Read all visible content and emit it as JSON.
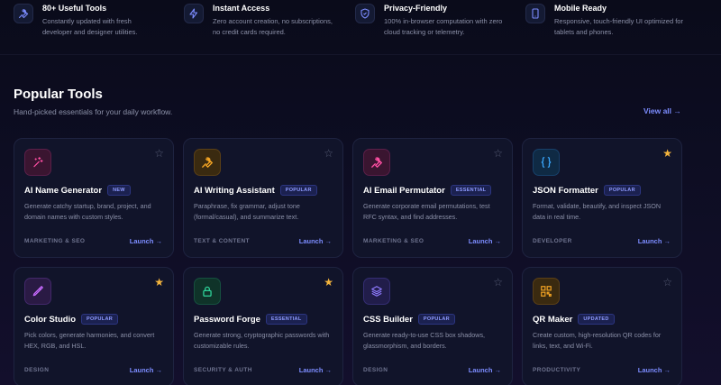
{
  "features": [
    {
      "icon": "wrench-icon",
      "title": "80+ Useful Tools",
      "desc": "Constantly updated with fresh developer and designer utilities."
    },
    {
      "icon": "lightning-icon",
      "title": "Instant Access",
      "desc": "Zero account creation, no subscriptions, no credit cards required."
    },
    {
      "icon": "shield-icon",
      "title": "Privacy-Friendly",
      "desc": "100% in-browser computation with zero cloud tracking or telemetry."
    },
    {
      "icon": "phone-icon",
      "title": "Mobile Ready",
      "desc": "Responsive, touch-friendly UI optimized for tablets and phones."
    }
  ],
  "section": {
    "title": "Popular Tools",
    "subtitle": "Hand-picked essentials for your daily workflow.",
    "view_all": "View all →"
  },
  "cards": [
    {
      "icon": "sparkles-icon",
      "accent": "#ff4fa3",
      "title": "AI Name Generator",
      "badge": "NEW",
      "desc": "Generate catchy startup, brand, project, and domain names with custom styles.",
      "category": "MARKETING & SEO",
      "starred": false,
      "launch": "Launch →"
    },
    {
      "icon": "wrench-icon",
      "accent": "#f5a524",
      "title": "AI Writing Assistant",
      "badge": "POPULAR",
      "desc": "Paraphrase, fix grammar, adjust tone (formal/casual), and summarize text.",
      "category": "TEXT & CONTENT",
      "starred": false,
      "launch": "Launch →"
    },
    {
      "icon": "wrench-icon",
      "accent": "#ff4fa3",
      "title": "AI Email Permutator",
      "badge": "ESSENTIAL",
      "desc": "Generate corporate email permutations, test RFC syntax, and find addresses.",
      "category": "MARKETING & SEO",
      "starred": false,
      "launch": "Launch →"
    },
    {
      "icon": "braces-icon",
      "accent": "#3aa8ff",
      "title": "JSON Formatter",
      "badge": "POPULAR",
      "desc": "Format, validate, beautify, and inspect JSON data in real time.",
      "category": "DEVELOPER",
      "starred": true,
      "launch": "Launch →"
    },
    {
      "icon": "pipette-icon",
      "accent": "#c86bff",
      "title": "Color Studio",
      "badge": "POPULAR",
      "desc": "Pick colors, generate harmonies, and convert HEX, RGB, and HSL.",
      "category": "DESIGN",
      "starred": true,
      "launch": "Launch →"
    },
    {
      "icon": "lock-icon",
      "accent": "#2fd39a",
      "title": "Password Forge",
      "badge": "ESSENTIAL",
      "desc": "Generate strong, cryptographic passwords with customizable rules.",
      "category": "SECURITY & AUTH",
      "starred": true,
      "launch": "Launch →"
    },
    {
      "icon": "layers-icon",
      "accent": "#8f7bff",
      "title": "CSS Builder",
      "badge": "POPULAR",
      "desc": "Generate ready-to-use CSS box shadows, glassmorphism, and borders.",
      "category": "DESIGN",
      "starred": false,
      "launch": "Launch →"
    },
    {
      "icon": "qr-code-icon",
      "accent": "#f5a524",
      "title": "QR Maker",
      "badge": "UPDATED",
      "desc": "Create custom, high-resolution QR codes for links, text, and Wi-Fi.",
      "category": "PRODUCTIVITY",
      "starred": false,
      "launch": "Launch →"
    }
  ],
  "colors": {
    "accent": "#7c8cff",
    "star_on": "#f5b53d",
    "star_off": "#5a5f78"
  }
}
